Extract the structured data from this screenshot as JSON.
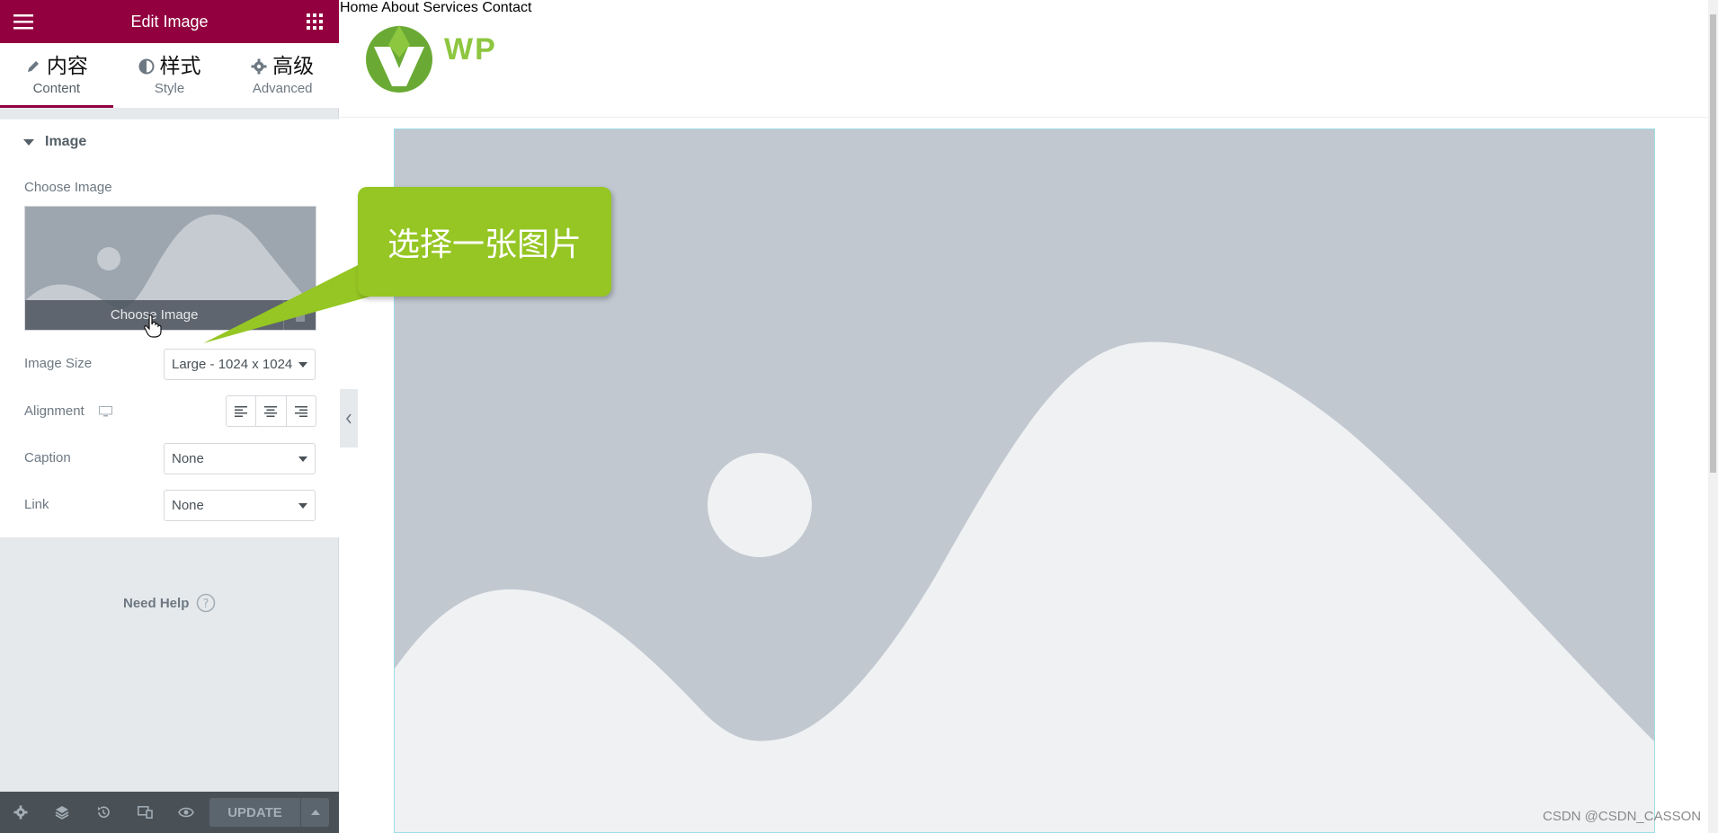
{
  "editor": {
    "header_title": "Edit Image",
    "tabs": [
      {
        "cn": "内容",
        "label": "Content",
        "icon": "pencil-icon",
        "active": true
      },
      {
        "cn": "样式",
        "label": "Style",
        "icon": "contrast-icon",
        "active": false
      },
      {
        "cn": "高级",
        "label": "Advanced",
        "icon": "gear-icon",
        "active": false
      }
    ],
    "section_title": "Image",
    "choose_image_label": "Choose Image",
    "choose_image_button": "Choose Image",
    "image_size": {
      "label": "Image Size",
      "value": "Large - 1024 x 1024"
    },
    "alignment_label": "Alignment",
    "caption": {
      "label": "Caption",
      "value": "None"
    },
    "link": {
      "label": "Link",
      "value": "None"
    },
    "need_help": "Need Help",
    "update_button": "UPDATE"
  },
  "site": {
    "logo_text": "WP",
    "nav": [
      "Home",
      "About",
      "Services",
      "Contact"
    ]
  },
  "callout_text": "选择一张图片",
  "watermark": "CSDN @CSDN_CASSON",
  "colors": {
    "brand": "#93003f",
    "callout": "#95c623",
    "logo_green": "#8dc63f",
    "placeholder": "#c1c8d0"
  }
}
